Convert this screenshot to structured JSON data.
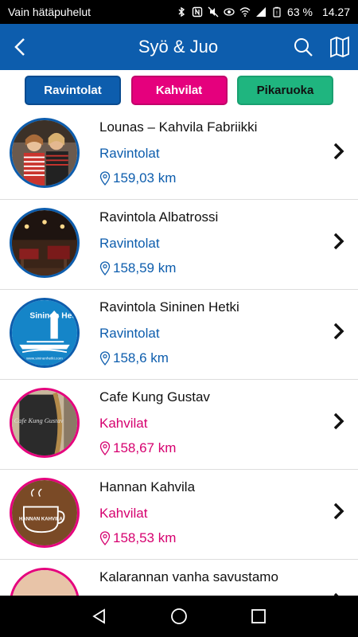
{
  "status_bar": {
    "carrier": "Vain hätäpuhelut",
    "battery": "63 %",
    "time": "14.27"
  },
  "app_bar": {
    "title": "Syö & Juo"
  },
  "filters": [
    {
      "label": "Ravintolat"
    },
    {
      "label": "Kahvilat"
    },
    {
      "label": "Pikaruoka"
    }
  ],
  "items": [
    {
      "name": "Lounas – Kahvila Fabriikki",
      "category": "Ravintolat",
      "distance": "159,03 km"
    },
    {
      "name": "Ravintola Albatrossi",
      "category": "Ravintolat",
      "distance": "158,59 km"
    },
    {
      "name": "Ravintola Sininen Hetki",
      "category": "Ravintolat",
      "distance": "158,6 km",
      "logo_text": "Sininen Hetki",
      "logo_url": "www.sininenhetki.com"
    },
    {
      "name": "Cafe Kung Gustav",
      "category": "Kahvilat",
      "distance": "158,67 km",
      "logo_text": "Cafe Kung Gustav"
    },
    {
      "name": "Hannan Kahvila",
      "category": "Kahvilat",
      "distance": "158,53 km",
      "logo_text": "HANNAN KAHVILA"
    },
    {
      "name": "Kalarannan vanha savustamo",
      "category": "",
      "distance": ""
    }
  ],
  "colors": {
    "primary": "#0d5dad",
    "pink": "#e5007d",
    "green": "#1fb57f"
  }
}
